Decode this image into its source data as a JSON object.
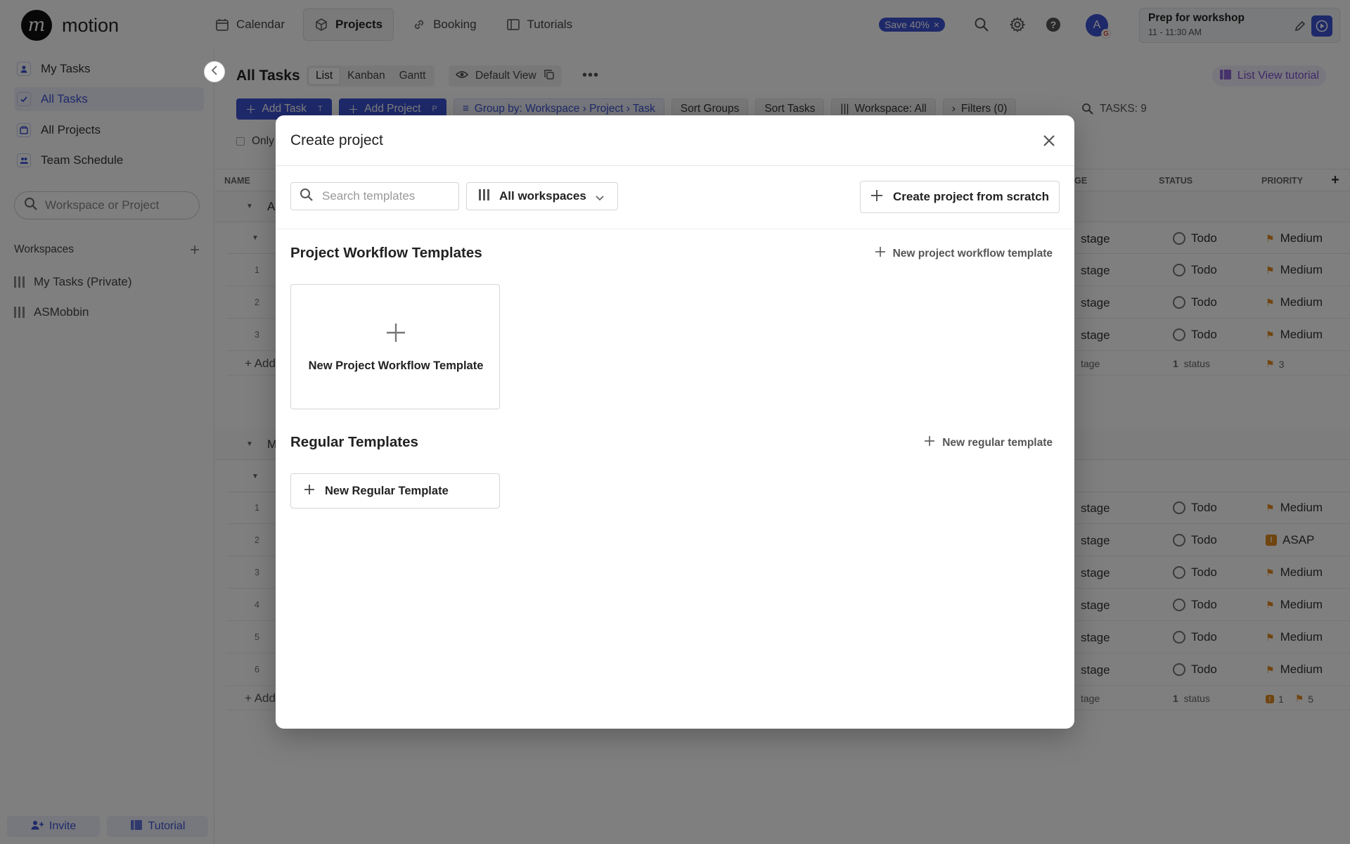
{
  "app": {
    "name": "motion"
  },
  "topnav": [
    {
      "label": "Calendar",
      "icon": "calendar-icon"
    },
    {
      "label": "Projects",
      "icon": "cube-icon",
      "active": true
    },
    {
      "label": "Booking",
      "icon": "link-icon"
    },
    {
      "label": "Tutorials",
      "icon": "book-icon"
    }
  ],
  "promo": {
    "label": "Save 40%",
    "close": "×"
  },
  "avatar": {
    "initial": "A",
    "provider": "G"
  },
  "event": {
    "title": "Prep for workshop",
    "time": "11 - 11:30 AM"
  },
  "sidebar": {
    "items": [
      {
        "label": "My Tasks",
        "icon": "person-icon"
      },
      {
        "label": "All Tasks",
        "icon": "check-icon",
        "active": true
      },
      {
        "label": "All Projects",
        "icon": "folder-icon"
      },
      {
        "label": "Team Schedule",
        "icon": "team-icon"
      }
    ],
    "search_placeholder": "Workspace or Project",
    "workspaces_label": "Workspaces",
    "workspaces": [
      "My Tasks (Private)",
      "ASMobbin"
    ],
    "footer": {
      "invite": "Invite",
      "tutorial": "Tutorial"
    }
  },
  "main": {
    "title": "All Tasks",
    "view_tabs": [
      "List",
      "Kanban",
      "Gantt"
    ],
    "default_view": "Default View",
    "tutorial_link": "List View tutorial",
    "toolbar": {
      "add_task": "Add Task",
      "add_task_key": "T",
      "add_project": "Add Project",
      "add_project_key": "P",
      "group_by": "Group by: Workspace › Project › Task",
      "sort_groups": "Sort Groups",
      "sort_tasks": "Sort Tasks",
      "workspace": "Workspace: All",
      "filters": "Filters (0)",
      "tasks_count": "TASKS: 9"
    },
    "only_label": "Only",
    "columns": {
      "name": "NAME",
      "stage": "GE",
      "status": "STATUS",
      "priority": "PRIORITY"
    },
    "group1": {
      "label": "A",
      "rows": [
        {
          "num": "",
          "stage": "stage",
          "status": "Todo",
          "priority": "Medium"
        },
        {
          "num": "1",
          "stage": "stage",
          "status": "Todo",
          "priority": "Medium"
        },
        {
          "num": "2",
          "stage": "stage",
          "status": "Todo",
          "priority": "Medium"
        },
        {
          "num": "3",
          "stage": "stage",
          "status": "Todo",
          "priority": "Medium"
        }
      ],
      "summary": {
        "add": "+ Add",
        "stage": "tage",
        "status_count": "1",
        "status_label": "status",
        "prio_count": "3"
      }
    },
    "group2": {
      "label": "M",
      "rows": [
        {
          "num": "1",
          "stage": "stage",
          "status": "Todo",
          "priority": "Medium"
        },
        {
          "num": "2",
          "stage": "stage",
          "status": "Todo",
          "priority": "ASAP"
        },
        {
          "num": "3",
          "stage": "stage",
          "status": "Todo",
          "priority": "Medium"
        },
        {
          "num": "4",
          "stage": "stage",
          "status": "Todo",
          "priority": "Medium"
        },
        {
          "num": "5",
          "stage": "stage",
          "status": "Todo",
          "priority": "Medium"
        },
        {
          "num": "6",
          "stage": "stage",
          "status": "Todo",
          "priority": "Medium"
        }
      ],
      "summary": {
        "add": "+ Add",
        "stage": "tage",
        "status_count": "1",
        "status_label": "status",
        "asap_count": "1",
        "prio_count": "5"
      }
    }
  },
  "modal": {
    "title": "Create project",
    "search_placeholder": "Search templates",
    "workspace_filter": "All workspaces",
    "create_scratch": "Create project from scratch",
    "workflow_section": "Project Workflow Templates",
    "new_workflow_link": "New project workflow template",
    "workflow_card_label": "New Project Workflow Template",
    "regular_section": "Regular Templates",
    "new_regular_link": "New regular template",
    "regular_button": "New Regular Template"
  },
  "colors": {
    "accent": "#3d52d5",
    "priority": "#e08a1e",
    "overlay": "rgba(0,0,0,0.5)"
  }
}
